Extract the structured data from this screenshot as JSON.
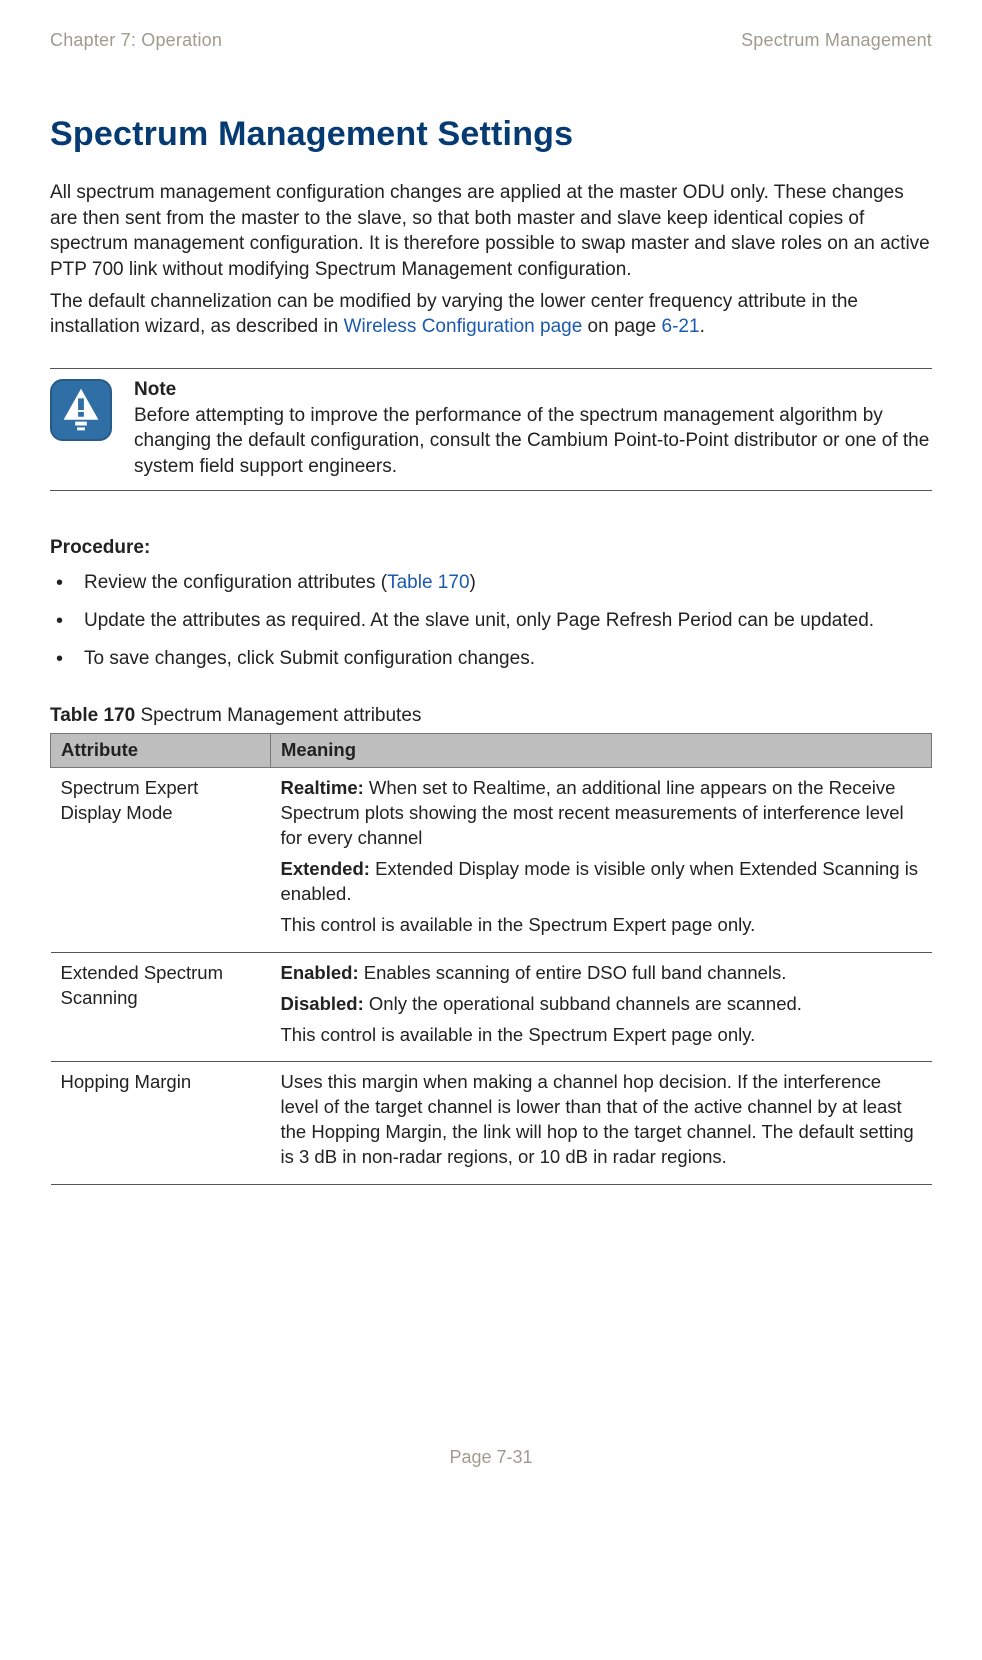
{
  "header": {
    "left": "Chapter 7:  Operation",
    "right": "Spectrum Management"
  },
  "title": "Spectrum Management Settings",
  "intro1": "All spectrum management configuration changes are applied at the master ODU only. These changes are then sent from the master to the slave, so that both master and slave keep identical copies of spectrum management configuration. It is therefore possible to swap master and slave roles on an active PTP 700 link without modifying Spectrum Management configuration.",
  "intro2_pre": "The default channelization can be modified by varying the lower center frequency attribute in the installation wizard, as described in ",
  "intro2_link": "Wireless Configuration page",
  "intro2_mid": " on page ",
  "intro2_pageref": "6-21",
  "intro2_post": ".",
  "note": {
    "head": "Note",
    "body": "Before attempting to improve the performance of the spectrum management algorithm by changing the default configuration, consult the Cambium Point-to-Point distributor or one of the system field support engineers."
  },
  "procedure_head": "Procedure:",
  "procedure": {
    "li1_pre": "Review the configuration attributes (",
    "li1_link": "Table 170",
    "li1_post": ")",
    "li2": "Update the attributes as required. At the slave unit, only Page Refresh Period can be updated.",
    "li3": "To save changes, click Submit configuration changes."
  },
  "table_caption": {
    "bold": "Table 170",
    "rest": "  Spectrum Management attributes"
  },
  "table_headers": {
    "c1": "Attribute",
    "c2": "Meaning"
  },
  "rows": [
    {
      "attr": "Spectrum Expert Display Mode",
      "lines": [
        {
          "b": "Realtime:",
          "t": " When set to Realtime, an additional line appears on the Receive Spectrum plots showing the most recent measurements of interference level for every channel"
        },
        {
          "b": "Extended:",
          "t": " Extended Display mode is visible only when Extended Scanning is enabled."
        },
        {
          "b": "",
          "t": "This control is available in the Spectrum Expert page only."
        }
      ]
    },
    {
      "attr": "Extended Spectrum Scanning",
      "lines": [
        {
          "b": "Enabled:",
          "t": " Enables scanning of entire DSO full band channels."
        },
        {
          "b": "Disabled:",
          "t": " Only the operational subband channels are scanned."
        },
        {
          "b": "",
          "t": "This control is available in the Spectrum Expert page only."
        }
      ]
    },
    {
      "attr": "Hopping Margin",
      "lines": [
        {
          "b": "",
          "t": "Uses this margin when making a channel hop decision. If the interference level of the target channel is lower than that of the active channel by at least the Hopping Margin, the link will hop to the target channel. The default setting is 3 dB in non-radar regions, or 10 dB in radar regions."
        }
      ]
    }
  ],
  "footer": "Page 7-31"
}
